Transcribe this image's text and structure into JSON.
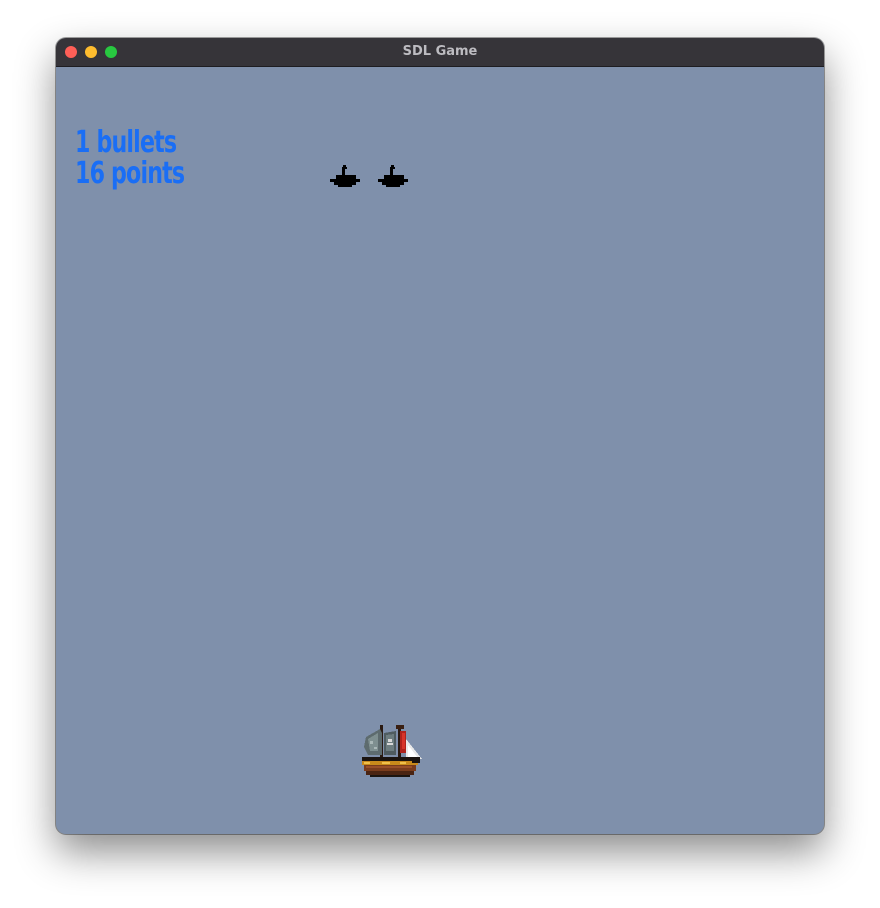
{
  "window": {
    "title": "SDL Game",
    "controls": {
      "close_color": "#fe5f57",
      "minimize_color": "#febc2e",
      "zoom_color": "#28c840"
    }
  },
  "game": {
    "background_color": "#7f90ab",
    "hud": {
      "bullets_text": "1 bullets",
      "points_text": "16 points",
      "color": "#1a6ef5"
    },
    "enemies": [
      {
        "icon": "cannon-silhouette-icon"
      },
      {
        "icon": "cannon-silhouette-icon"
      }
    ],
    "player": {
      "icon": "pirate-ship-icon"
    }
  }
}
